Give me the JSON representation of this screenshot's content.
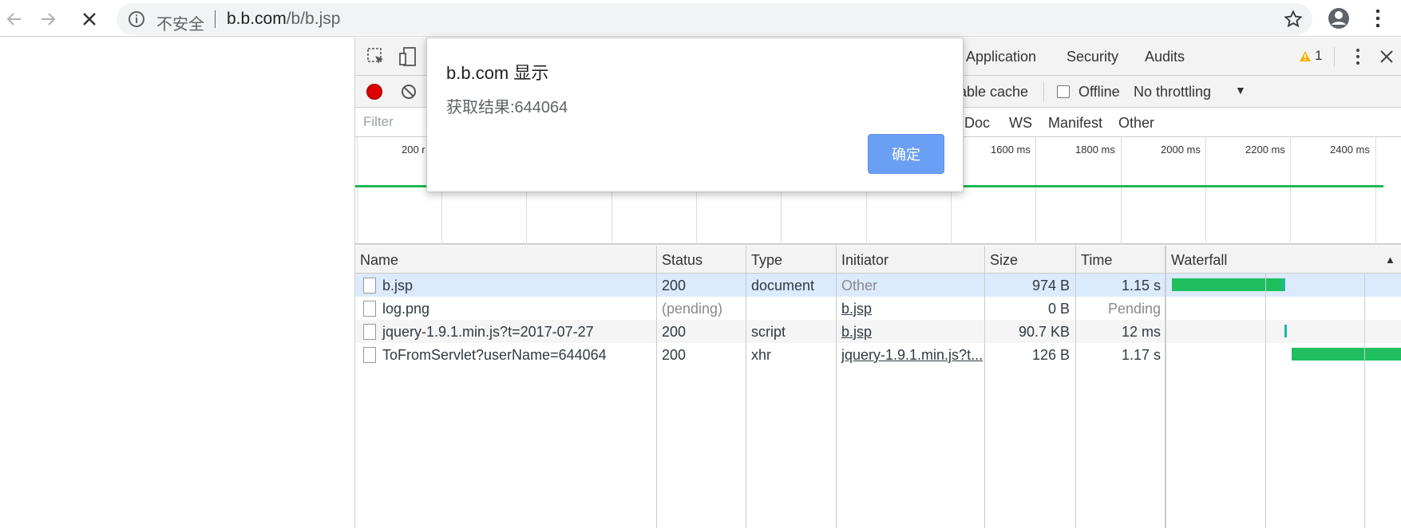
{
  "browser": {
    "security_label": "不安全",
    "url_host": "b.b.com",
    "url_path": "/b/b.jsp"
  },
  "devtools": {
    "tabs": [
      "Application",
      "Security",
      "Audits"
    ],
    "warning_count": "1",
    "controls": {
      "disable_cache_label": "able cache",
      "offline_label": "Offline",
      "throttling_label": "No throttling"
    },
    "filter": {
      "placeholder": "Filter",
      "types": [
        "Doc",
        "WS",
        "Manifest",
        "Other"
      ]
    },
    "overview": {
      "ticks": [
        "200 r",
        "1600 ms",
        "1800 ms",
        "2000 ms",
        "2200 ms",
        "2400 ms"
      ]
    },
    "table": {
      "headers": [
        "Name",
        "Status",
        "Type",
        "Initiator",
        "Size",
        "Time",
        "Waterfall"
      ],
      "rows": [
        {
          "name": "b.jsp",
          "status": "200",
          "type": "document",
          "initiator": "Other",
          "size": "974 B",
          "time": "1.15 s"
        },
        {
          "name": "log.png",
          "status": "(pending)",
          "type": "",
          "initiator": "b.jsp",
          "size": "0 B",
          "time": "Pending"
        },
        {
          "name": "jquery-1.9.1.min.js?t=2017-07-27",
          "status": "200",
          "type": "script",
          "initiator": "b.jsp",
          "size": "90.7 KB",
          "time": "12 ms"
        },
        {
          "name": "ToFromServlet?userName=644064",
          "status": "200",
          "type": "xhr",
          "initiator": "jquery-1.9.1.min.js?t...",
          "size": "126 B",
          "time": "1.17 s"
        }
      ]
    }
  },
  "dialog": {
    "title": "b.b.com 显示",
    "message": "获取结果:644064",
    "ok_label": "确定"
  },
  "colors": {
    "waterfall_green": "#1fbf60",
    "record_red": "#e00000",
    "dialog_button": "#6b9ff4"
  }
}
